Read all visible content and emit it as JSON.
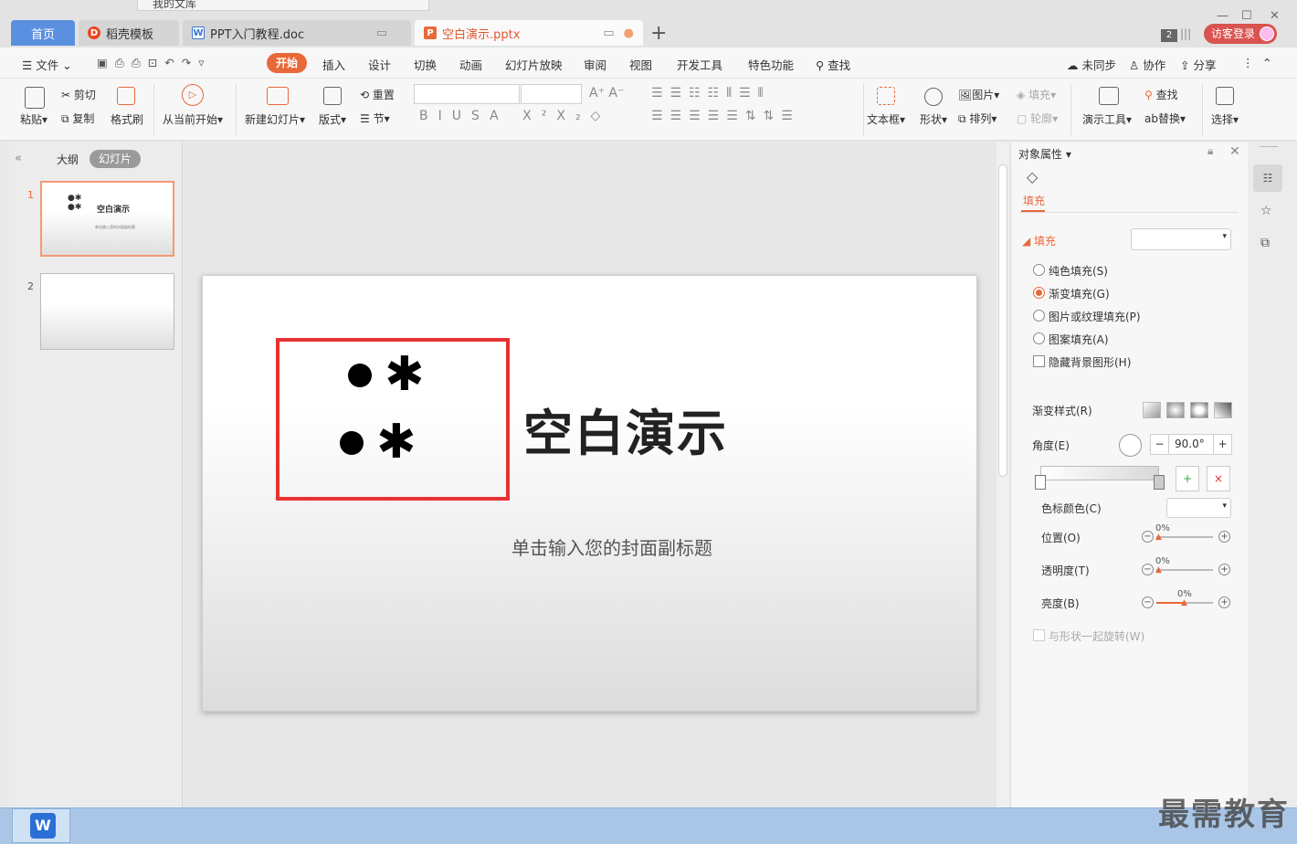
{
  "window": {
    "background_tab_title": "我的文库",
    "tabs": [
      {
        "label": "首页",
        "icon": "home-tab"
      },
      {
        "label": "稻壳模板",
        "icon": "docer-icon"
      },
      {
        "label": "PPT入门教程.doc",
        "icon": "word-doc-icon"
      },
      {
        "label": "空白演示.pptx",
        "icon": "ppt-icon",
        "active": true
      }
    ],
    "window_count": "2",
    "login_label": "访客登录"
  },
  "menu": {
    "file": "文件",
    "tabs": [
      "开始",
      "插入",
      "设计",
      "切换",
      "动画",
      "幻灯片放映",
      "审阅",
      "视图",
      "开发工具",
      "特色功能"
    ],
    "search": "查找",
    "sync": "未同步",
    "collab": "协作",
    "share": "分享"
  },
  "ribbon": {
    "paste": "粘贴",
    "cut": "剪切",
    "copy": "复制",
    "format_painter": "格式刷",
    "play_from_current": "从当前开始",
    "new_slide": "新建幻灯片",
    "layout": "版式",
    "reset": "重置",
    "section": "节",
    "textbox": "文本框",
    "shape": "形状",
    "picture": "图片",
    "arrange": "排列",
    "fill": "填充",
    "outline": "轮廓",
    "presentation_tools": "演示工具",
    "find": "查找",
    "replace": "替换",
    "select": "选择"
  },
  "left_panel": {
    "outline_tab": "大纲",
    "slides_tab": "幻灯片",
    "thumbs": [
      {
        "number": "1",
        "title": "空白演示",
        "subtitle": "单击输入您的封面副标题"
      },
      {
        "number": "2",
        "title": "",
        "subtitle": ""
      }
    ]
  },
  "slide": {
    "title": "空白演示",
    "subtitle": "单击输入您的封面副标题",
    "star_glyph": "✱"
  },
  "properties": {
    "header": "对象属性",
    "fill_tab": "填充",
    "fill_section": "填充",
    "options": [
      "纯色填充(S)",
      "渐变填充(G)",
      "图片或纹理填充(P)",
      "图案填充(A)"
    ],
    "selected_option": "渐变填充(G)",
    "hide_bg": "隐藏背景图形(H)",
    "gradient_style": "渐变样式(R)",
    "angle_label": "角度(E)",
    "angle_value": "90.0°",
    "stop_color": "色标颜色(C)",
    "position": "位置(O)",
    "position_value": "0%",
    "transparency": "透明度(T)",
    "transparency_value": "0%",
    "brightness": "亮度(B)",
    "brightness_value": "0%",
    "rotate_with_shape": "与形状一起旋转(W)"
  },
  "watermark": "最需教育"
}
